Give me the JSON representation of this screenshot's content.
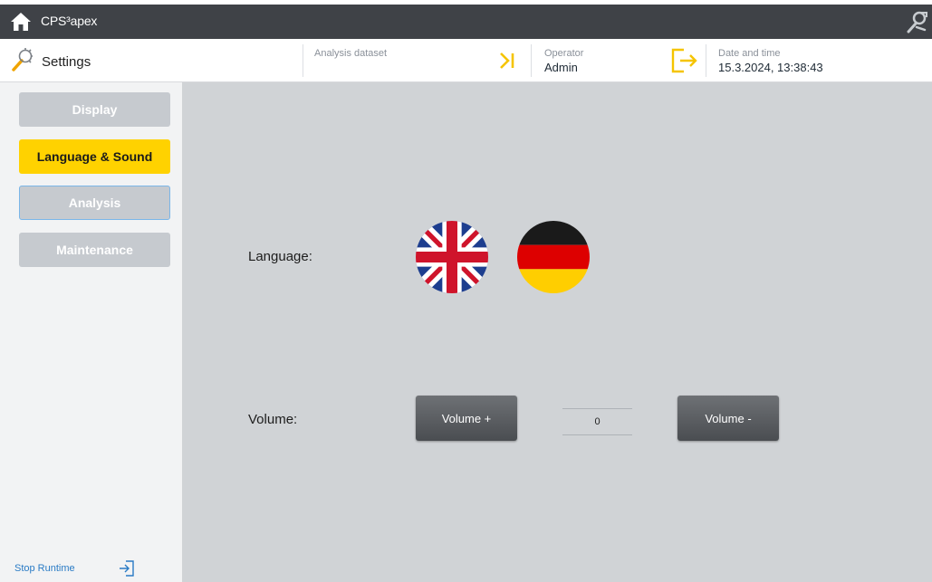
{
  "titlebar": {
    "app_title": "CPS³apex",
    "home_icon": "home-icon",
    "tool_icon": "wrench-icon"
  },
  "header": {
    "page_title": "Settings",
    "analysis_dataset_label": "Analysis dataset",
    "analysis_dataset_value": "",
    "operator_label": "Operator",
    "operator_value": "Admin",
    "datetime_label": "Date and time",
    "datetime_value": "15.3.2024, 13:38:43",
    "accent_color": "#f5c400"
  },
  "sidebar": {
    "items": [
      {
        "label": "Display",
        "state": "inactive"
      },
      {
        "label": "Language & Sound",
        "state": "active"
      },
      {
        "label": "Analysis",
        "state": "focused"
      },
      {
        "label": "Maintenance",
        "state": "inactive"
      }
    ],
    "stop_runtime_label": "Stop Runtime"
  },
  "content": {
    "language_label": "Language:",
    "languages": [
      "English (UK flag)",
      "German (DE flag)"
    ],
    "volume_label": "Volume:",
    "volume_plus_label": "Volume +",
    "volume_value": "0",
    "volume_minus_label": "Volume -"
  }
}
